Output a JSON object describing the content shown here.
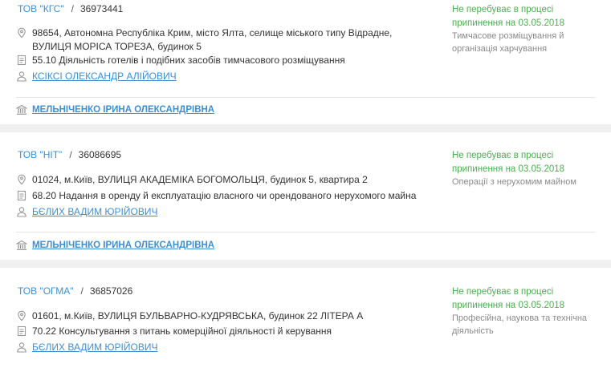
{
  "companies": [
    {
      "name": "ТОВ \"КГС\"",
      "code": "36973441",
      "status": [
        "Не перебуває в процесі",
        "припинення на 03.05.2018"
      ],
      "activity": [
        "Тимчасове розміщування й",
        "організація харчування"
      ],
      "address": [
        "98654, Автономна Республіка Крим, місто Ялта, селище міського типу Відрадне,",
        "ВУЛИЦЯ МОРІСА ТОРЕЗА, будинок 5"
      ],
      "kved": "55.10 Діяльність готелів і подібних засобів тимчасового розміщування",
      "director": "КСІКСІ ОЛЕКСАНДР АЛІЙОВИЧ",
      "registrar": "МЕЛЬНІЧЕНКО ІРИНА ОЛЕКСАНДРІВНА"
    },
    {
      "name": "ТОВ \"НІТ\"",
      "code": "36086695",
      "status": [
        "Не перебуває в процесі",
        "припинення на 03.05.2018"
      ],
      "activity": [
        "Операції з нерухомим майном"
      ],
      "address": [
        "01024, м.Київ, ВУЛИЦЯ АКАДЕМІКА БОГОМОЛЬЦЯ, будинок 5, квартира 2"
      ],
      "kved": "68.20 Надання в оренду й експлуатацію власного чи орендованого нерухомого майна",
      "director": "БЄЛИХ ВАДИМ ЮРІЙОВИЧ",
      "registrar": "МЕЛЬНІЧЕНКО ІРИНА ОЛЕКСАНДРІВНА"
    },
    {
      "name": "ТОВ \"ОГМА\"",
      "code": "36857026",
      "status": [
        "Не перебуває в процесі",
        "припинення на 03.05.2018"
      ],
      "activity": [
        "Професійна, наукова та технічна",
        "діяльність"
      ],
      "address": [
        "01601, м.Київ, ВУЛИЦЯ БУЛЬВАРНО-КУДРЯВСЬКА, будинок 22 ЛІТЕРА А"
      ],
      "kved": "70.22 Консультування з питань комерційної діяльності й керування",
      "director": "БЄЛИХ ВАДИМ ЮРІЙОВИЧ"
    }
  ],
  "separator": "/",
  "colors": {
    "link": "#3b8fd6",
    "status_green": "#4caf50",
    "muted": "#8a8a8a",
    "separator_bg": "#f0f0f0"
  },
  "icons": {
    "address": "location-pin-icon",
    "kved": "document-icon",
    "director": "person-icon",
    "registrar": "bank-icon"
  }
}
